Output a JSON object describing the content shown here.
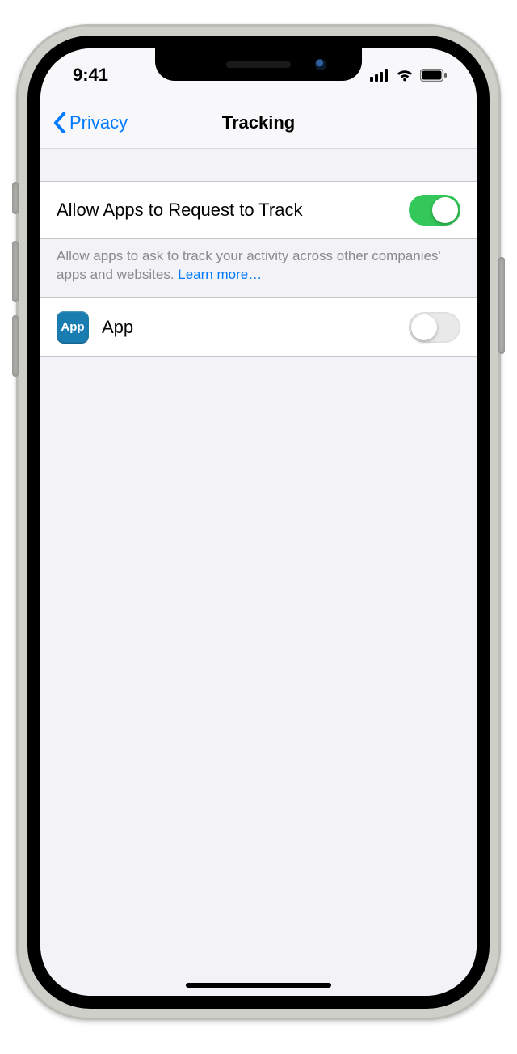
{
  "status": {
    "time": "9:41"
  },
  "nav": {
    "back_label": "Privacy",
    "title": "Tracking"
  },
  "settings": {
    "allow_tracking": {
      "label": "Allow Apps to Request to Track",
      "enabled": true,
      "footer_text": "Allow apps to ask to track your activity across other companies' apps and websites. ",
      "learn_more": "Learn more…"
    },
    "apps": [
      {
        "icon_label": "App",
        "name": "App",
        "enabled": false
      }
    ]
  },
  "colors": {
    "tint": "#007aff",
    "toggle_on": "#34c759"
  }
}
